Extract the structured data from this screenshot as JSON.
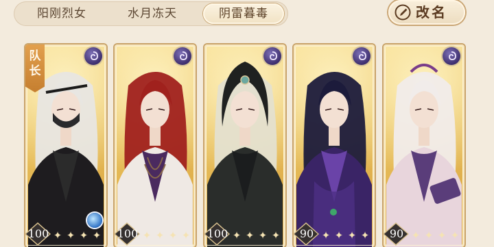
{
  "tabs": [
    {
      "label": "阳刚烈女",
      "selected": false
    },
    {
      "label": "水月冻天",
      "selected": false
    },
    {
      "label": "阴雷暮毒",
      "selected": true
    }
  ],
  "rename_button": {
    "label": "改名",
    "icon": "brush-icon"
  },
  "captain_label": "队长",
  "cards": [
    {
      "name": "masked-white-hair-swordsman",
      "level": "100",
      "stars": 5,
      "element_icon": "element-swirl-icon",
      "captain": true,
      "skill_badge": true,
      "hair": "#e8e6e2",
      "robe": "#1e1c1f",
      "accent": "#2b2b2b"
    },
    {
      "name": "red-hair-warrior",
      "level": "100",
      "stars": 5,
      "element_icon": "element-swirl-icon",
      "captain": false,
      "skill_badge": false,
      "hair": "#a0211d",
      "robe": "#efe9e4",
      "accent": "#4a2a5f"
    },
    {
      "name": "hooded-pale-hair-scholar",
      "level": "100",
      "stars": 5,
      "element_icon": "element-swirl-icon",
      "captain": false,
      "skill_badge": false,
      "hair": "#e4e0cf",
      "robe": "#2a2d2b",
      "accent": "#1b1d1e"
    },
    {
      "name": "dark-hair-noble",
      "level": "90",
      "stars": 5,
      "element_icon": "element-swirl-icon",
      "captain": false,
      "skill_badge": false,
      "hair": "#1c1b3b",
      "robe": "#3a2466",
      "accent": "#6a43a8"
    },
    {
      "name": "white-hair-fan-master",
      "level": "90",
      "stars": 5,
      "element_icon": "element-swirl-icon",
      "captain": false,
      "skill_badge": false,
      "hair": "#f1ecea",
      "robe": "#e8d5dc",
      "accent": "#5a3d7a"
    }
  ]
}
